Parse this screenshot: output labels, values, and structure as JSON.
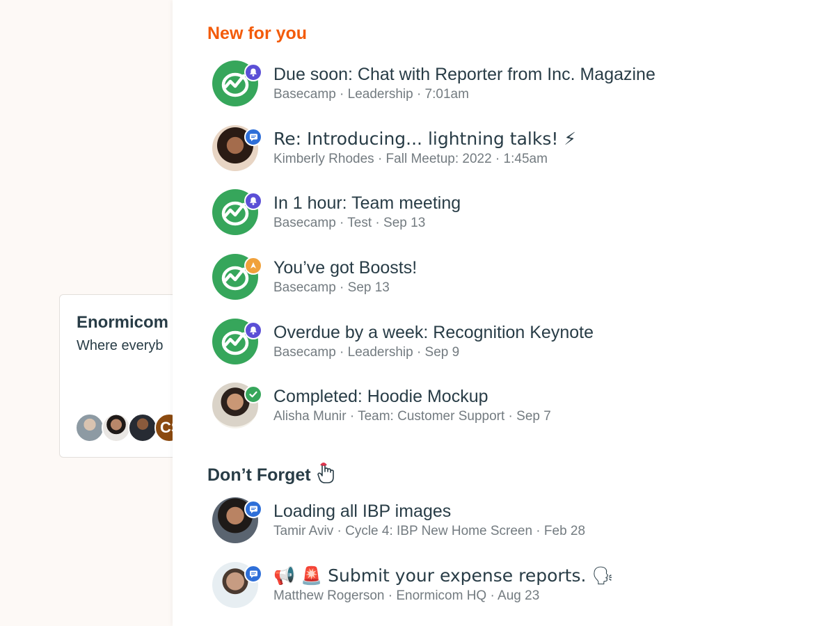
{
  "background_card": {
    "title": "Enormicom",
    "description": "Where everyb",
    "avatars": [
      "avatar-1",
      "avatar-2",
      "avatar-3"
    ],
    "initials": "CS"
  },
  "sections": {
    "new_for_you": "New for you",
    "dont_forget": "Don’t Forget"
  },
  "new_items": [
    {
      "title": "Due soon: Chat with Reporter from Inc. Magazine",
      "meta": "Basecamp · Leadership · 7:01am",
      "avatar": "basecamp-logo",
      "badge": "bell-icon"
    },
    {
      "title": "Re: Introducing... lightning talks! ⚡",
      "meta": "Kimberly Rhodes · Fall Meetup: 2022 · 1:45am",
      "avatar": "kimberly-rhodes",
      "badge": "message-icon"
    },
    {
      "title": "In 1 hour: Team meeting",
      "meta": "Basecamp · Test · Sep 13",
      "avatar": "basecamp-logo",
      "badge": "bell-icon"
    },
    {
      "title": "You’ve got Boosts!",
      "meta": "Basecamp · Sep 13",
      "avatar": "basecamp-logo",
      "badge": "boost-icon"
    },
    {
      "title": "Overdue by a week: Recognition Keynote",
      "meta": "Basecamp · Leadership · Sep 9",
      "avatar": "basecamp-logo",
      "badge": "bell-icon"
    },
    {
      "title": "Completed: Hoodie Mockup",
      "meta": "Alisha Munir · Team: Customer Support · Sep 7",
      "avatar": "alisha-munir",
      "badge": "check-icon"
    }
  ],
  "forget_items": [
    {
      "title": "Loading all IBP images",
      "meta": "Tamir Aviv · Cycle 4: IBP New Home Screen · Feb 28",
      "avatar": "tamir-aviv",
      "badge": "message-icon"
    },
    {
      "title": "📢 🚨 Submit your expense reports. 🗣",
      "meta": "Matthew Rogerson · Enormicom HQ · Aug 23",
      "avatar": "matthew-rogerson",
      "badge": "message-icon"
    }
  ],
  "colors": {
    "accent": "#f35b0a",
    "basecamp_green": "#36a65b",
    "bell_badge": "#5b4fd6",
    "message_badge": "#2e6fd8",
    "boost_badge": "#f0a13b"
  }
}
